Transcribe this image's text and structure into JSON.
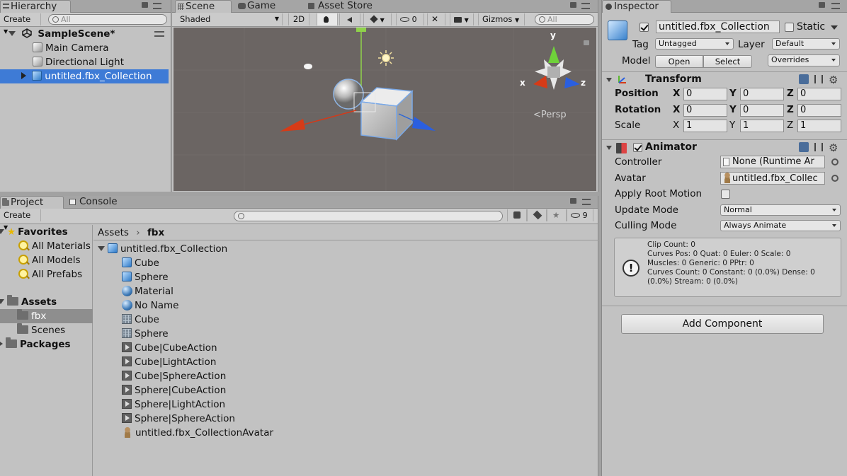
{
  "hierarchy": {
    "tab_label": "Hierarchy",
    "create_label": "Create",
    "search_placeholder": "All",
    "scene_name": "SampleScene*",
    "items": [
      {
        "label": "Main Camera"
      },
      {
        "label": "Directional Light"
      },
      {
        "label": "untitled.fbx_Collection"
      }
    ]
  },
  "scene_view": {
    "tabs": [
      "Scene",
      "Game",
      "Asset Store"
    ],
    "shading_mode": "Shaded",
    "mode_2d_label": "2D",
    "hidden_count": "0",
    "gizmos_label": "Gizmos",
    "search_placeholder": "All",
    "persp_label": "<Persp",
    "axis_labels": {
      "x": "x",
      "y": "y",
      "z": "z"
    }
  },
  "project": {
    "tabs": [
      "Project",
      "Console"
    ],
    "create_label": "Create",
    "hidden_count": "9",
    "favorites_label": "Favorites",
    "favorites": [
      "All Materials",
      "All Models",
      "All Prefabs"
    ],
    "assets_label": "Assets",
    "asset_folders": [
      "fbx",
      "Scenes"
    ],
    "packages_label": "Packages",
    "breadcrumb": [
      "Assets",
      "fbx"
    ],
    "root_asset": "untitled.fbx_Collection",
    "asset_items": [
      {
        "icon": "cube",
        "label": "Cube"
      },
      {
        "icon": "cube",
        "label": "Sphere"
      },
      {
        "icon": "sphere",
        "label": "Material"
      },
      {
        "icon": "sphere",
        "label": "No Name"
      },
      {
        "icon": "mesh",
        "label": "Cube"
      },
      {
        "icon": "mesh",
        "label": "Sphere"
      },
      {
        "icon": "anim",
        "label": "Cube|CubeAction"
      },
      {
        "icon": "anim",
        "label": "Cube|LightAction"
      },
      {
        "icon": "anim",
        "label": "Cube|SphereAction"
      },
      {
        "icon": "anim",
        "label": "Sphere|CubeAction"
      },
      {
        "icon": "anim",
        "label": "Sphere|LightAction"
      },
      {
        "icon": "anim",
        "label": "Sphere|SphereAction"
      },
      {
        "icon": "avatar",
        "label": "untitled.fbx_CollectionAvatar"
      }
    ]
  },
  "inspector": {
    "tab_label": "Inspector",
    "object_name": "untitled.fbx_Collection",
    "static_label": "Static",
    "tag_label": "Tag",
    "tag_value": "Untagged",
    "layer_label": "Layer",
    "layer_value": "Default",
    "model_label": "Model",
    "open_label": "Open",
    "select_label": "Select",
    "overrides_label": "Overrides",
    "transform": {
      "title": "Transform",
      "rows": [
        {
          "label": "Position",
          "x": "0",
          "y": "0",
          "z": "0"
        },
        {
          "label": "Rotation",
          "x": "0",
          "y": "0",
          "z": "0"
        },
        {
          "label": "Scale",
          "x": "1",
          "y": "1",
          "z": "1"
        }
      ],
      "axis": {
        "x": "X",
        "y": "Y",
        "z": "Z"
      }
    },
    "animator": {
      "title": "Animator",
      "controller_label": "Controller",
      "controller_value": "None (Runtime Ar",
      "avatar_label": "Avatar",
      "avatar_value": "untitled.fbx_Collec",
      "apply_root_motion_label": "Apply Root Motion",
      "update_mode_label": "Update Mode",
      "update_mode_value": "Normal",
      "culling_mode_label": "Culling Mode",
      "culling_mode_value": "Always Animate",
      "info_lines": [
        "Clip Count: 0",
        "Curves Pos: 0 Quat: 0 Euler: 0 Scale: 0",
        "Muscles: 0 Generic: 0 PPtr: 0",
        "Curves Count: 0 Constant: 0 (0.0%) Dense: 0",
        "(0.0%) Stream: 0 (0.0%)"
      ]
    },
    "add_component_label": "Add Component"
  },
  "colors": {
    "selection": "#3e7bd6",
    "scene_bg": "#6b6563",
    "panel_bg": "#c2c2c2"
  }
}
